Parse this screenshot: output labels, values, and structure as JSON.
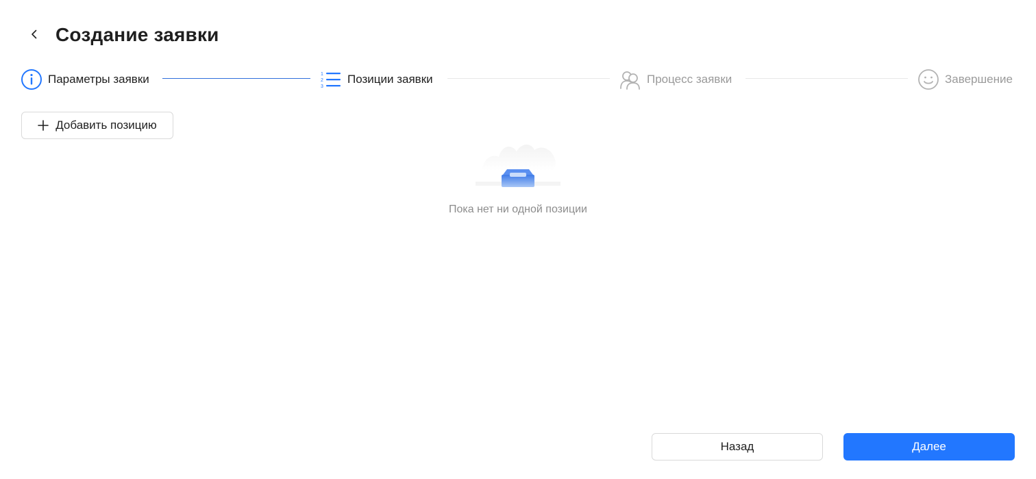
{
  "header": {
    "title": "Создание заявки",
    "back_icon": "chevron-left-icon"
  },
  "steps": [
    {
      "label": "Параметры заявки",
      "icon": "info-circle-icon",
      "state": "done"
    },
    {
      "label": "Позиции заявки",
      "icon": "numbered-list-icon",
      "state": "active"
    },
    {
      "label": "Процесс заявки",
      "icon": "users-icon",
      "state": "pending"
    },
    {
      "label": "Завершение",
      "icon": "smile-icon",
      "state": "pending"
    }
  ],
  "toolbar": {
    "add_label": "Добавить позицию",
    "add_icon": "plus-icon"
  },
  "empty_state": {
    "text": "Пока нет ни одной позиции",
    "icon": "empty-inbox-icon"
  },
  "footer": {
    "back_label": "Назад",
    "next_label": "Далее"
  },
  "colors": {
    "accent": "#2277ff",
    "step_done_line": "#2f6fdc",
    "pending_text": "#9a9a9a"
  }
}
